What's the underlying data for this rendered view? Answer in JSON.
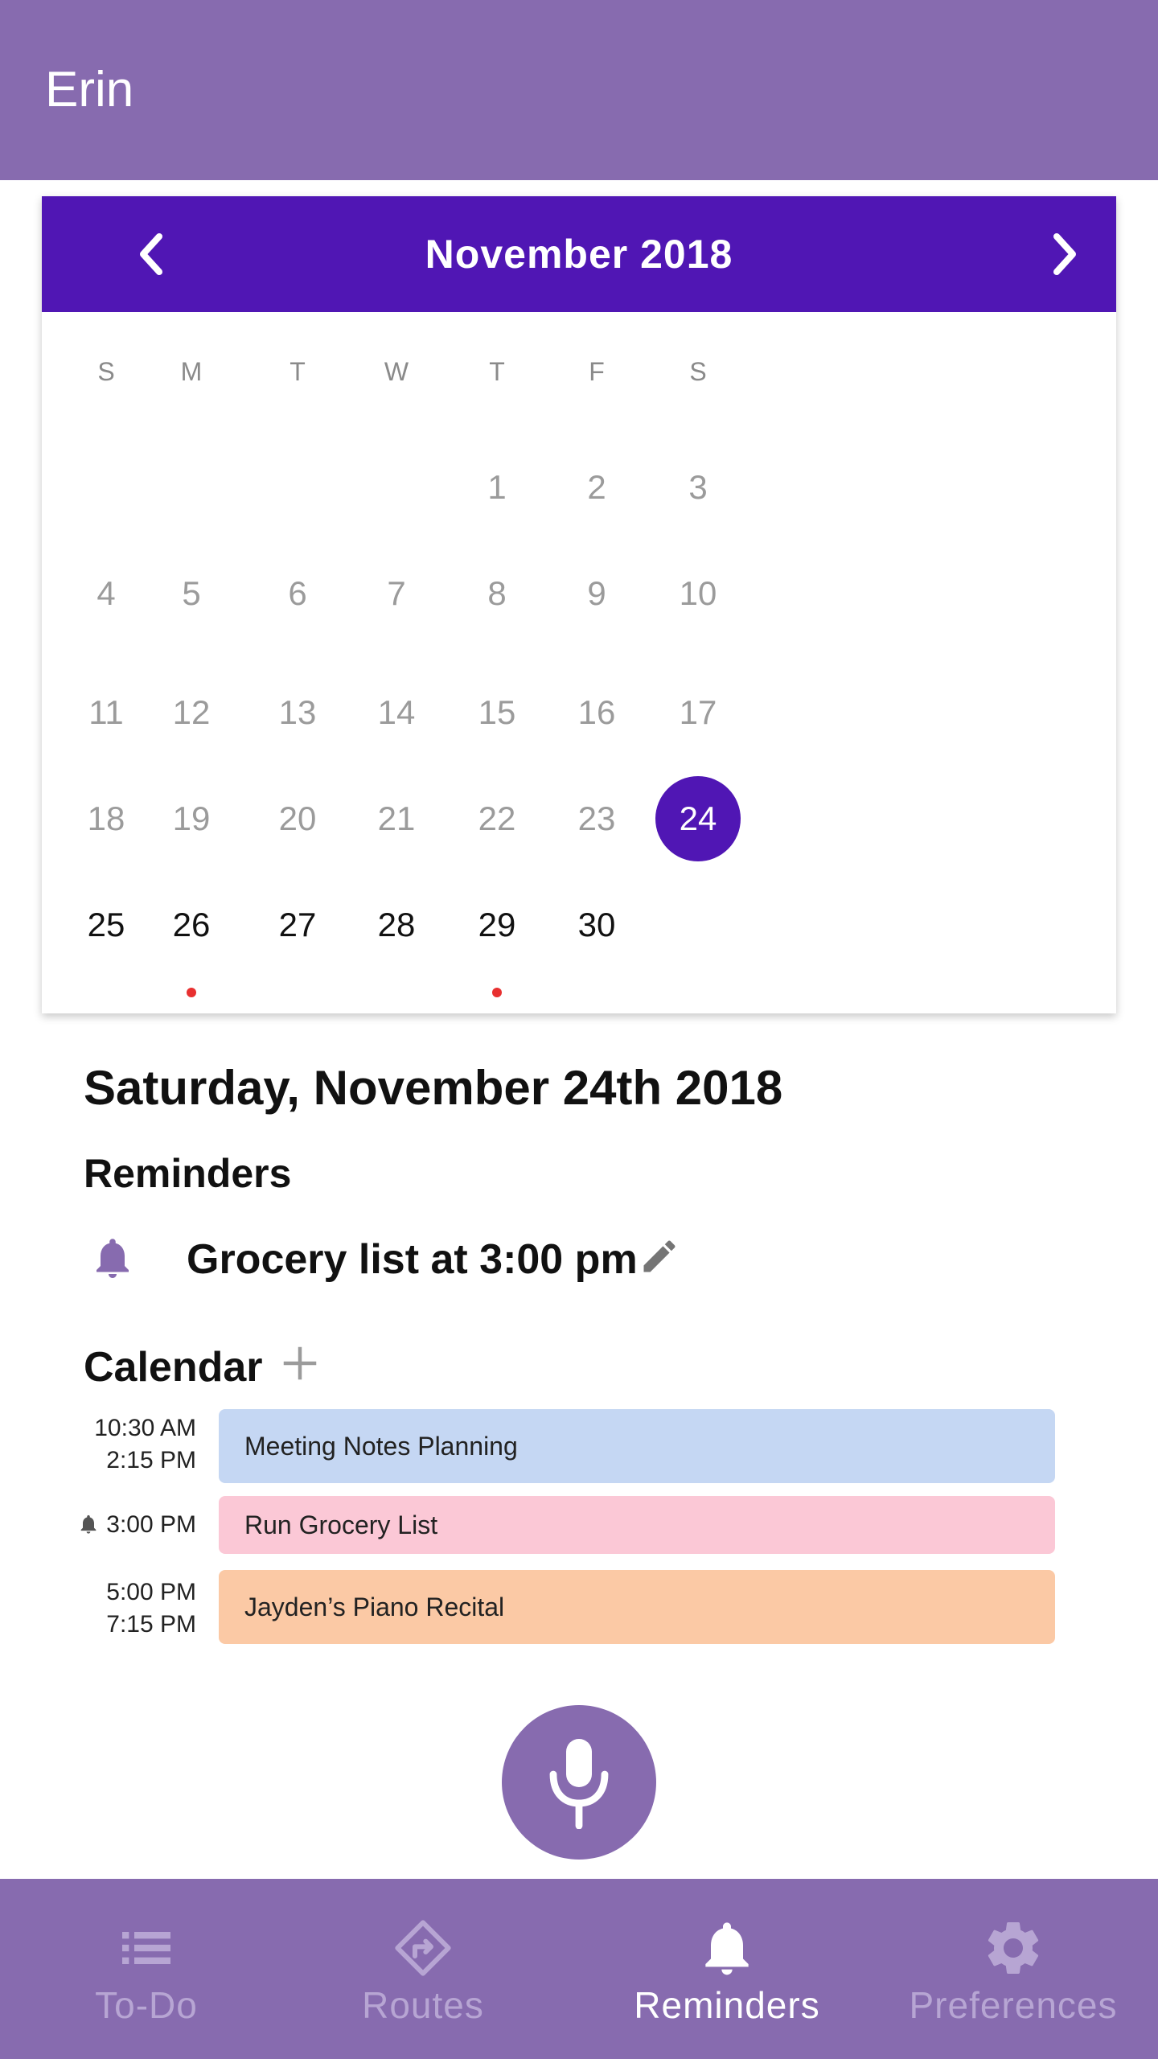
{
  "header": {
    "title": "Erin"
  },
  "calendar": {
    "month_label": "November 2018",
    "prev_icon": "chevron-left-icon",
    "next_icon": "chevron-right-icon",
    "weekdays": [
      "S",
      "M",
      "T",
      "W",
      "T",
      "F",
      "S"
    ],
    "selected_day": "24",
    "weeks": [
      [
        "",
        "",
        "",
        "",
        "1",
        "2",
        "3"
      ],
      [
        "4",
        "5",
        "6",
        "7",
        "8",
        "9",
        "10"
      ],
      [
        "11",
        "12",
        "13",
        "14",
        "15",
        "16",
        "17"
      ],
      [
        "18",
        "19",
        "20",
        "21",
        "22",
        "23",
        "24"
      ],
      [
        "25",
        "26",
        "27",
        "28",
        "29",
        "30",
        ""
      ]
    ],
    "days_with_events": [
      "26",
      "29"
    ],
    "accent_color": "#5016b4",
    "event_dot_color": "#e83030"
  },
  "selected_date": {
    "heading": "Saturday, November 24th 2018"
  },
  "reminders": {
    "heading": "Reminders",
    "items": [
      {
        "text": "Grocery list at 3:00 pm",
        "icon": "bell-icon",
        "edit_icon": "pencil-icon"
      }
    ]
  },
  "calendar_section": {
    "heading": "Calendar",
    "add_icon": "plus-icon",
    "events": [
      {
        "start": "10:30 AM",
        "end": "2:15 PM",
        "title": "Meeting Notes Planning",
        "color": "#c5d7f3"
      },
      {
        "start": "3:00 PM",
        "end": "",
        "title": "Run Grocery List",
        "color": "#fbc8d6",
        "has_reminder": true
      },
      {
        "start": "5:00 PM",
        "end": "7:15 PM",
        "title": "Jayden’s Piano Recital",
        "color": "#fbc9a5"
      }
    ]
  },
  "mic": {
    "icon": "microphone-icon"
  },
  "bottom_nav": {
    "items": [
      {
        "label": "To-Do",
        "icon": "list-icon",
        "active": false
      },
      {
        "label": "Routes",
        "icon": "directions-icon",
        "active": false
      },
      {
        "label": "Reminders",
        "icon": "bell-icon",
        "active": true
      },
      {
        "label": "Preferences",
        "icon": "gear-icon",
        "active": false
      }
    ]
  },
  "colors": {
    "primary": "#876baf",
    "accent": "#5016b4"
  }
}
